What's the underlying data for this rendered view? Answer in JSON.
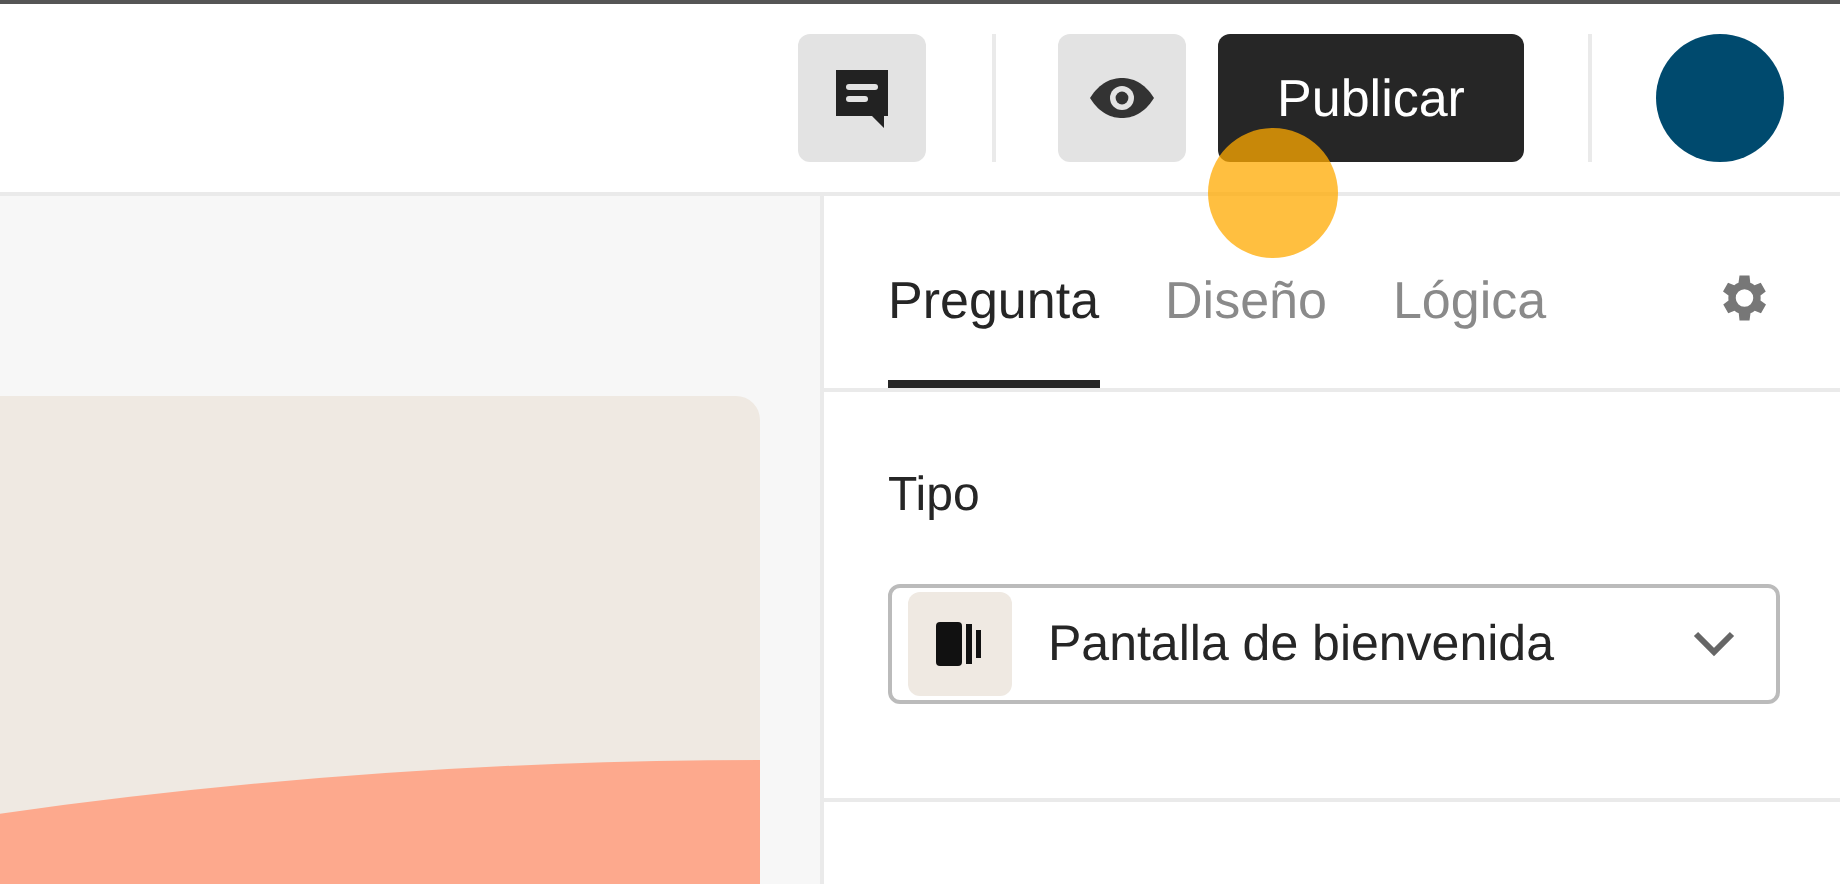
{
  "toolbar": {
    "publish_button": "Publicar"
  },
  "tabs": [
    {
      "label": "Pregunta",
      "selected": true
    },
    {
      "label": "Diseño",
      "selected": false
    },
    {
      "label": "Lógica",
      "selected": false
    }
  ],
  "type_section": {
    "label": "Tipo",
    "dropdown_value": "Pantalla de bienvenida"
  }
}
